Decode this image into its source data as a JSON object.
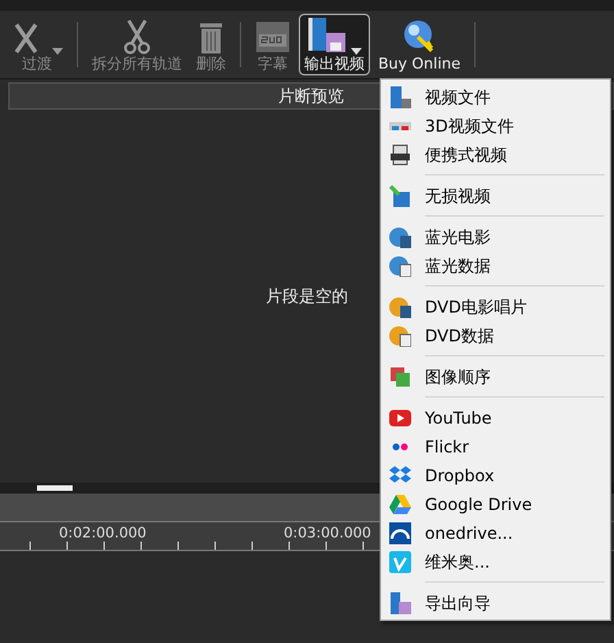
{
  "toolbar": {
    "buttons": [
      {
        "label": "过渡",
        "disabled": true,
        "selected": false,
        "dropdown": true
      },
      {
        "label": "拆分所有轨道",
        "disabled": true,
        "selected": false,
        "dropdown": false
      },
      {
        "label": "删除",
        "disabled": true,
        "selected": false,
        "dropdown": false
      },
      {
        "label": "字幕",
        "disabled": true,
        "selected": false,
        "dropdown": false
      },
      {
        "label": "输出视频",
        "disabled": false,
        "selected": true,
        "dropdown": true
      },
      {
        "label": "Buy Online",
        "disabled": false,
        "selected": false,
        "dropdown": false
      }
    ]
  },
  "preview": {
    "title": "片断预览",
    "empty_message": "片段是空的",
    "scroll": {
      "level": 0.06
    }
  },
  "timeline": {
    "labels": [
      "0:02:00.000",
      "0:03:00.000"
    ]
  },
  "export_menu": {
    "groups": [
      [
        "视频文件",
        "3D视频文件",
        "便携式视频"
      ],
      [
        "无损视频"
      ],
      [
        "蓝光电影",
        "蓝光数据"
      ],
      [
        "DVD电影唱片",
        "DVD数据"
      ],
      [
        "图像顺序"
      ],
      [
        "YouTube",
        "Flickr",
        "Dropbox",
        "Google Drive",
        "onedrive...",
        "维米奥..."
      ],
      [
        "导出向导"
      ]
    ]
  }
}
